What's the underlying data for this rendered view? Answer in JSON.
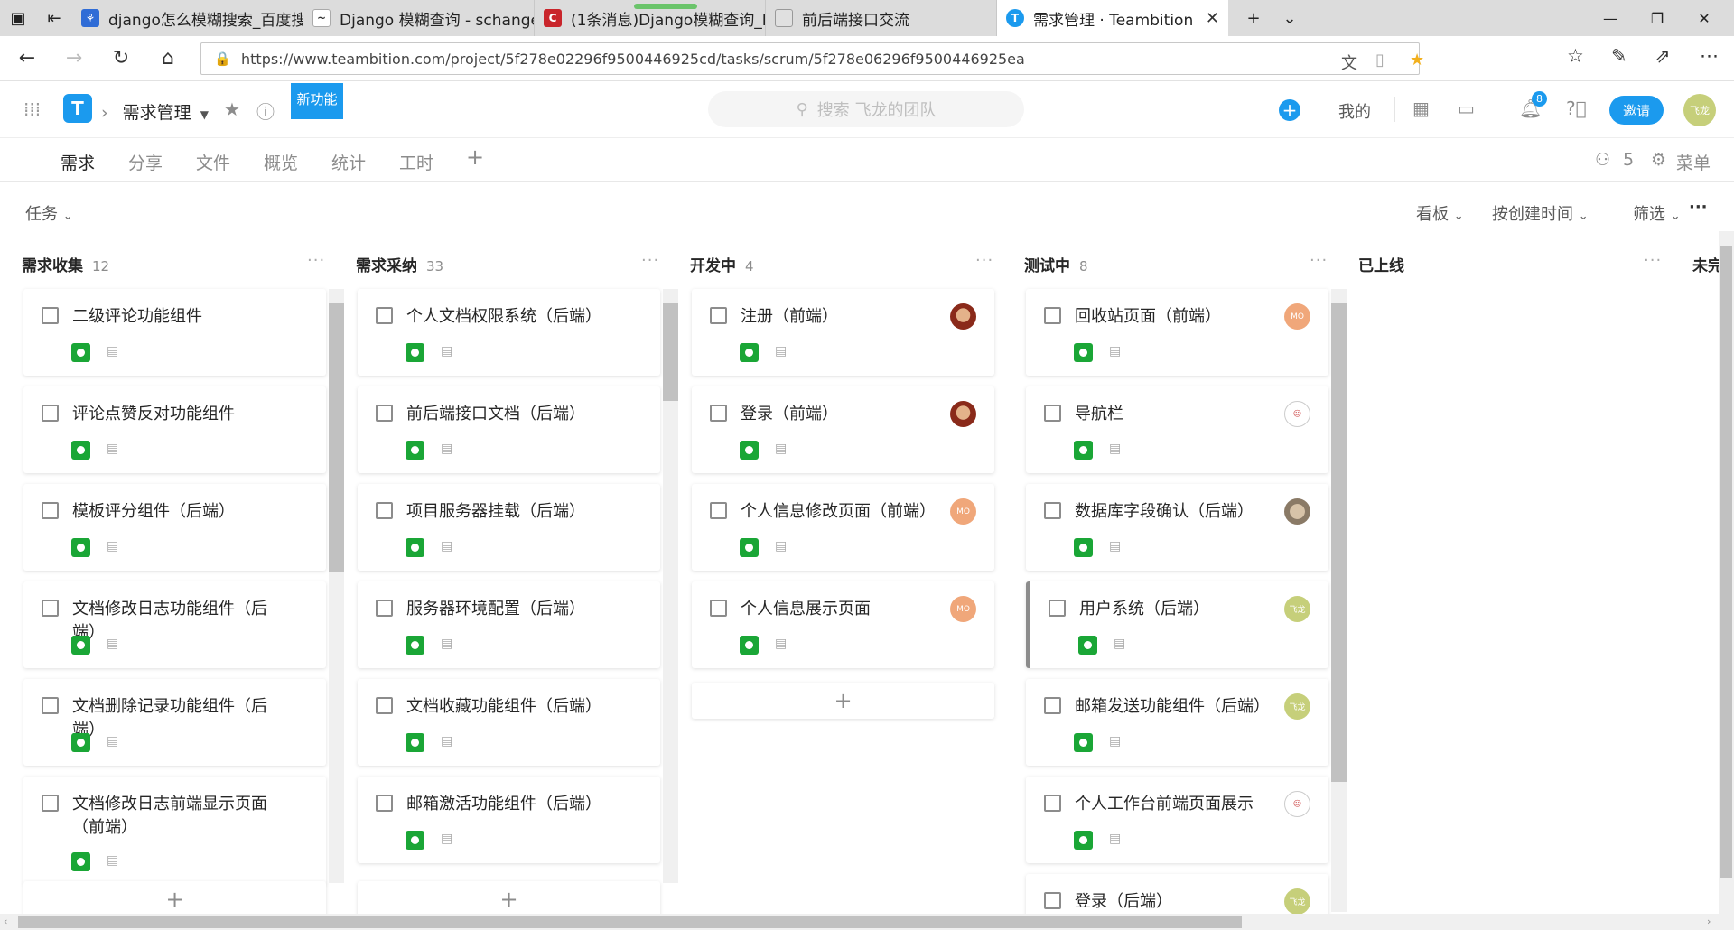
{
  "browser": {
    "tabs": [
      {
        "title": "django怎么模糊搜索_百度搜",
        "fav_color": "#2f6cd6",
        "fav_text": "🐾"
      },
      {
        "title": "Django 模糊查询 - schange",
        "fav_color": "#ffffff",
        "fav_text": ""
      },
      {
        "title": "(1条消息)Django模糊查询_L",
        "fav_color": "#c9252b",
        "fav_text": "C"
      },
      {
        "title": "前后端接口交流",
        "fav_color": "#9e9e9e",
        "fav_text": ""
      },
      {
        "title": "需求管理 · Teambition",
        "fav_color": "#1b9aee",
        "fav_text": "T"
      }
    ],
    "url": "https://www.teambition.com/project/5f278e02296f9500446925cd/tasks/scrum/5f278e06296f9500446925ea"
  },
  "header": {
    "project": "需求管理",
    "new_feature": "新功能",
    "search_placeholder": "搜索 飞龙的团队",
    "mine": "我的",
    "notify_count": "8",
    "invite": "邀请",
    "avatar": "飞龙"
  },
  "subnav": {
    "tabs": [
      "需求",
      "分享",
      "文件",
      "概览",
      "统计",
      "工时"
    ],
    "members": "5",
    "menu": "菜单"
  },
  "toolbar": {
    "task": "任务",
    "view": "看板",
    "sort": "按创建时间",
    "filter": "筛选"
  },
  "columns": [
    {
      "name": "需求收集",
      "count": "12",
      "cards": [
        "二级评论功能组件",
        "评论点赞反对功能组件",
        "模板评分组件（后端）",
        "文档修改日志功能组件（后端）",
        "文档删除记录功能组件（后端）",
        "文档修改日志前端显示页面（前端）"
      ]
    },
    {
      "name": "需求采纳",
      "count": "33",
      "cards": [
        "个人文档权限系统（后端）",
        "前后端接口文档（后端）",
        "项目服务器挂载（后端）",
        "服务器环境配置（后端）",
        "文档收藏功能组件（后端）",
        "邮箱激活功能组件（后端）"
      ]
    },
    {
      "name": "开发中",
      "count": "4",
      "cards": [
        "注册（前端）",
        "登录（前端）",
        "个人信息修改页面（前端）",
        "个人信息展示页面"
      ]
    },
    {
      "name": "测试中",
      "count": "8",
      "cards": [
        "回收站页面（前端）",
        "导航栏",
        "数据库字段确认（后端）",
        "用户系统（后端）",
        "邮箱发送功能组件（后端）",
        "个人工作台前端页面展示",
        "登录（后端）"
      ]
    },
    {
      "name": "已上线",
      "count": "",
      "cards": []
    },
    {
      "name": "未完",
      "count": "",
      "cards": []
    }
  ],
  "avatars": {
    "mo": "MO",
    "feilong": "飞龙"
  }
}
